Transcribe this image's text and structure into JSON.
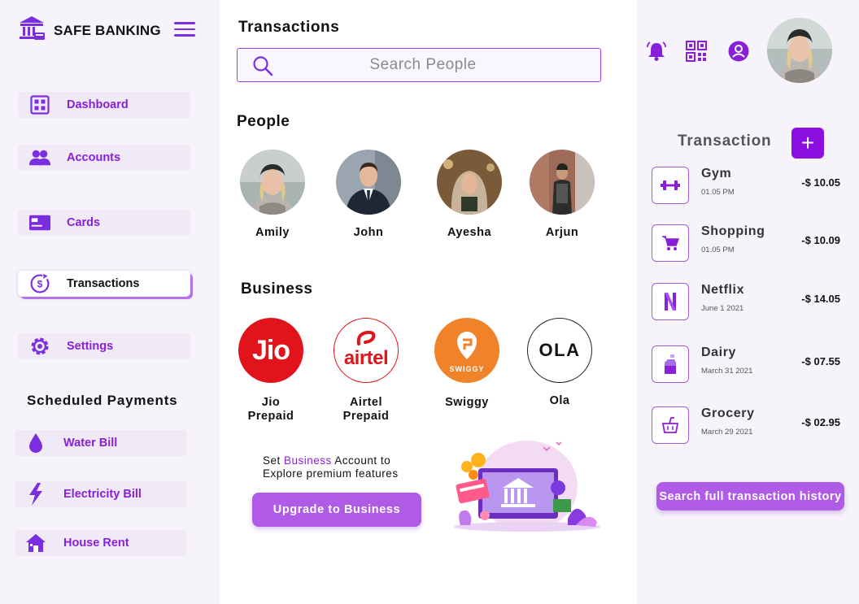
{
  "brand": {
    "name": "SAFE BANKING",
    "icon": "bank-icon"
  },
  "sidebar": {
    "menu_icon": "hamburger-icon",
    "items": [
      {
        "label": "Dashboard",
        "icon": "dashboard-grid-icon"
      },
      {
        "label": "Accounts",
        "icon": "users-icon"
      },
      {
        "label": "Cards",
        "icon": "card-icon"
      },
      {
        "label": "Transactions",
        "icon": "dollar-cycle-icon",
        "active": true
      },
      {
        "label": "Settings",
        "icon": "gear-icon"
      }
    ],
    "scheduled_title": "Scheduled Payments",
    "scheduled": [
      {
        "label": "Water Bill",
        "icon": "water-drop-icon"
      },
      {
        "label": "Electricity Bill",
        "icon": "lightning-icon"
      },
      {
        "label": "House Rent",
        "icon": "house-icon"
      }
    ]
  },
  "main": {
    "title": "Transactions",
    "search": {
      "placeholder": "Search People"
    },
    "people_title": "People",
    "people": [
      {
        "name": "Amily"
      },
      {
        "name": "John"
      },
      {
        "name": "Ayesha"
      },
      {
        "name": "Arjun"
      }
    ],
    "business_title": "Business",
    "businesses": [
      {
        "name": "Jio\nPrepaid",
        "logo": "Jio"
      },
      {
        "name": "Airtel\nPrepaid",
        "logo": "airtel"
      },
      {
        "name": "Swiggy",
        "logo": "SWIGGY"
      },
      {
        "name": "Ola",
        "logo": "OLA"
      }
    ],
    "promo": {
      "line1_prefix": "Set ",
      "line1_highlight": "Business",
      "line1_suffix": " Account to",
      "line2": "Explore premium features",
      "button": "Upgrade to Business"
    }
  },
  "right": {
    "icons": [
      "bell-icon",
      "qr-code-icon",
      "user-circle-icon"
    ],
    "title": "Transaction",
    "add_label": "+",
    "transactions": [
      {
        "name": "Gym",
        "time": "01.05 PM",
        "amount": "-$ 10.05",
        "icon": "dumbbell-icon"
      },
      {
        "name": "Shopping",
        "time": "01.05 PM",
        "amount": "-$ 10.09",
        "icon": "cart-icon"
      },
      {
        "name": "Netflix",
        "time": "June 1 2021",
        "amount": "-$ 14.05",
        "icon": "netflix-icon"
      },
      {
        "name": "Dairy",
        "time": "March 31 2021",
        "amount": "-$ 07.55",
        "icon": "milk-icon"
      },
      {
        "name": "Grocery",
        "time": "March 29 2021",
        "amount": "-$ 02.95",
        "icon": "grocery-icon"
      }
    ],
    "history_button": "Search full transaction history"
  },
  "colors": {
    "accent": "#8a1fd8",
    "button": "#b05ae8",
    "panel": "#f6f3fb"
  }
}
